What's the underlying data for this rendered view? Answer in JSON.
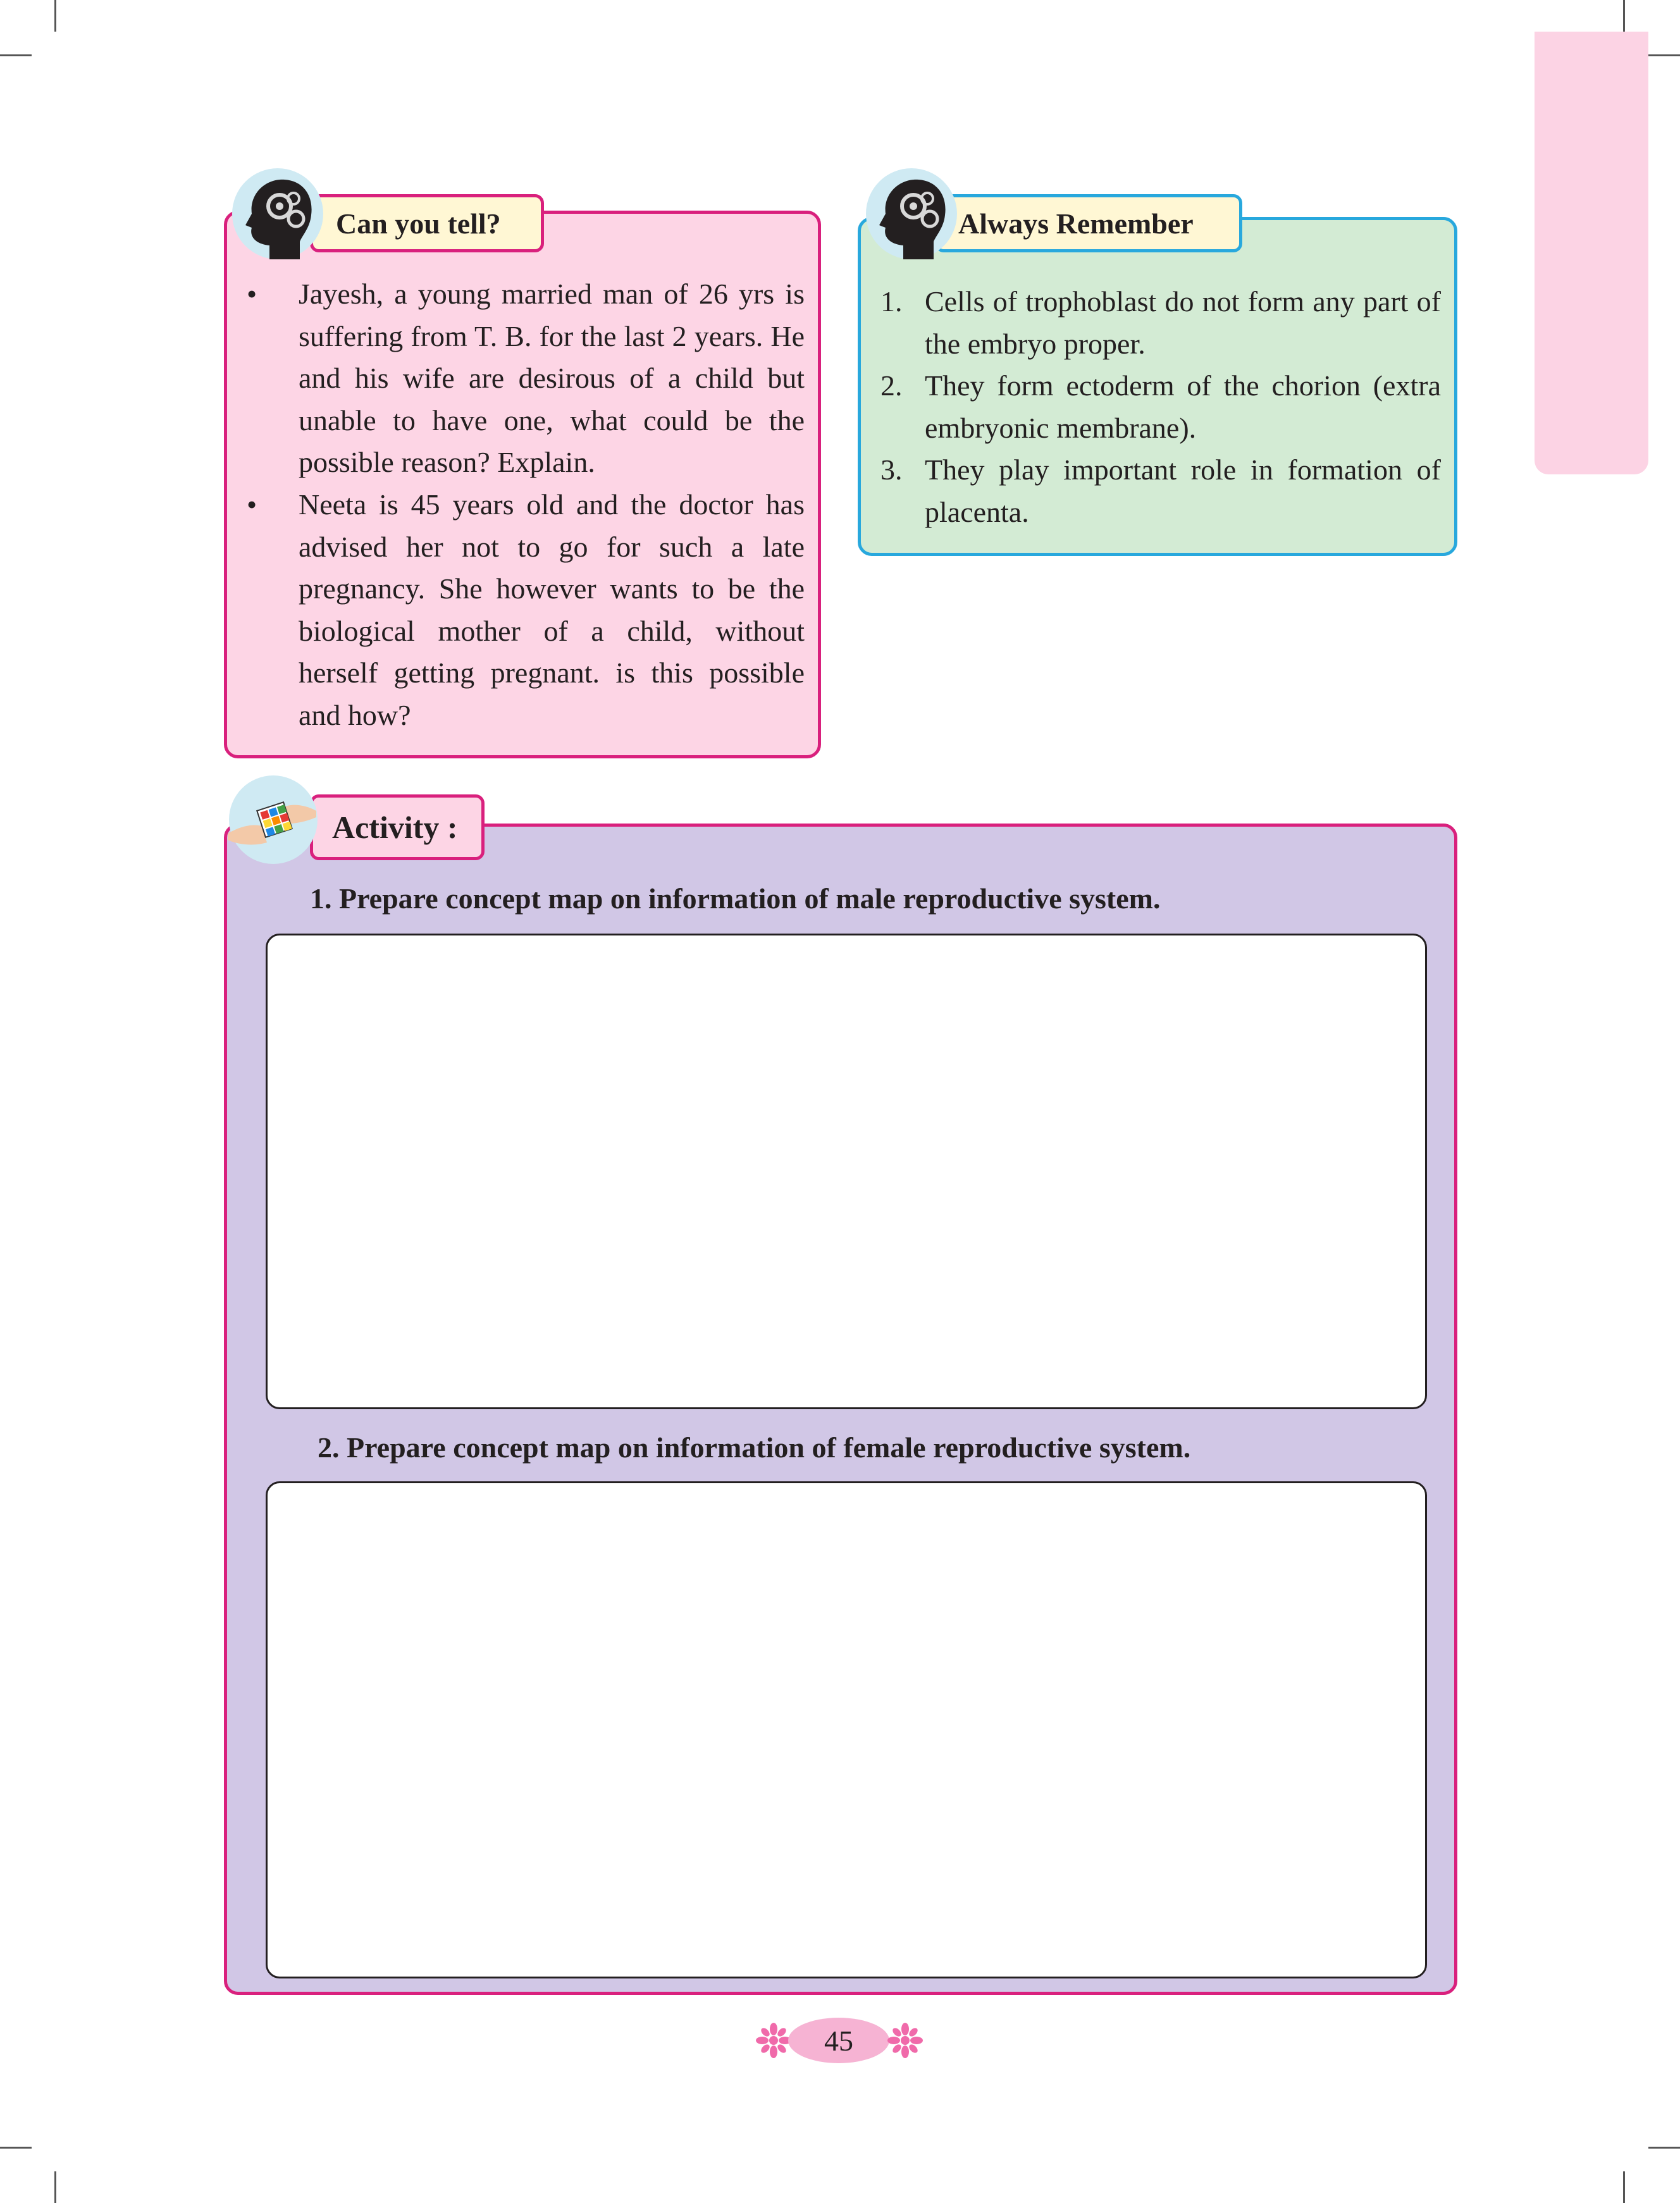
{
  "can_you_tell": {
    "title": "Can you tell?",
    "items": [
      "Jayesh, a young married man of 26 yrs is suffering from T. B. for the last 2 years. He and his wife are desirous of a child but unable to have one, what could be the possible reason? Explain.",
      "Neeta is 45 years old and the doctor has advised her not to go for such a late pregnancy. She however wants to be the biological mother of a child, without herself getting pregnant. is this possible and how?"
    ]
  },
  "always_remember": {
    "title": "Always Remember",
    "items": [
      {
        "num": "1.",
        "text": "Cells of trophoblast do not form any part of the embryo proper."
      },
      {
        "num": "2.",
        "text": "They form ectoderm of the chorion (extra embryonic membrane)."
      },
      {
        "num": "3.",
        "text": "They play important role in formation of placenta."
      }
    ]
  },
  "activity": {
    "title": "Activity :",
    "task_1": "1. Prepare concept map on information of male reproductive system.",
    "task_2": "2. Prepare concept map on information of female reproductive system."
  },
  "footer": {
    "page_number": "45"
  },
  "colors": {
    "pink_box": "#fdd5e5",
    "magenta_border": "#d9207d",
    "green_box": "#d3ebd4",
    "blue_border": "#28a8dd",
    "lavender_box": "#d1c7e6",
    "tag_yellow": "#fff7d4",
    "side_tab": "#fcd3e4"
  }
}
